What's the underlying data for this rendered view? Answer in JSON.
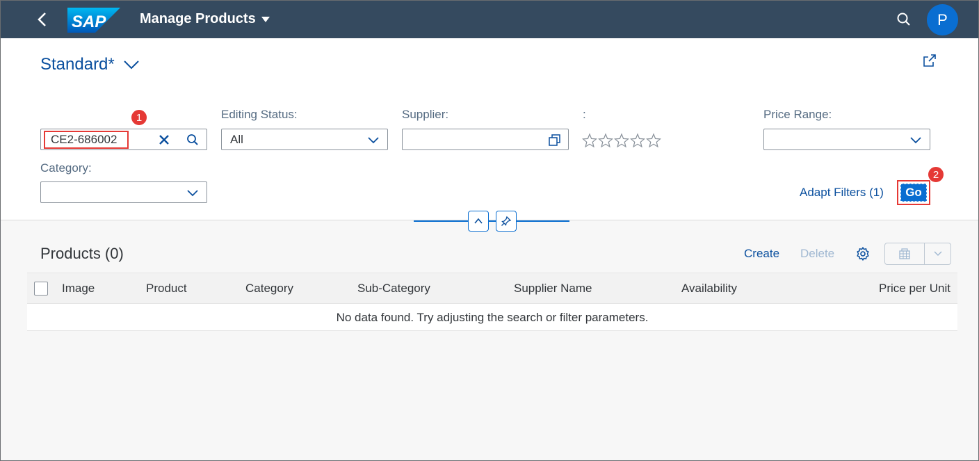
{
  "shell": {
    "logo_text": "SAP",
    "app_title": "Manage Products",
    "avatar_initial": "P"
  },
  "header": {
    "variant_name": "Standard*"
  },
  "filters": {
    "search_value": "CE2-686002",
    "editing_status_label": "Editing Status:",
    "editing_status_value": "All",
    "supplier_label": "Supplier:",
    "supplier_value": "",
    "rating_label": ":",
    "rating_value": 0,
    "rating_max": 5,
    "price_range_label": "Price Range:",
    "price_range_value": "",
    "category_label": "Category:",
    "category_value": "",
    "adapt_filters_label": "Adapt Filters (1)",
    "go_label": "Go"
  },
  "annotations": {
    "badge1": "1",
    "badge2": "2"
  },
  "table": {
    "title": "Products (0)",
    "create_label": "Create",
    "delete_label": "Delete",
    "columns": [
      "Image",
      "Product",
      "Category",
      "Sub-Category",
      "Supplier Name",
      "Availability",
      "Price per Unit"
    ],
    "no_data_text": "No data found. Try adjusting the search or filter parameters."
  },
  "colors": {
    "shell_bg": "#354a5f",
    "brand_blue": "#0a6ed1",
    "link_blue": "#0a4f9e",
    "highlight_red": "#e53935"
  },
  "icons": [
    "back-icon",
    "chevron-down-icon",
    "search-icon",
    "share-icon",
    "clear-icon",
    "value-help-icon",
    "star-icon",
    "collapse-icon",
    "pin-icon",
    "gear-icon",
    "export-icon"
  ]
}
